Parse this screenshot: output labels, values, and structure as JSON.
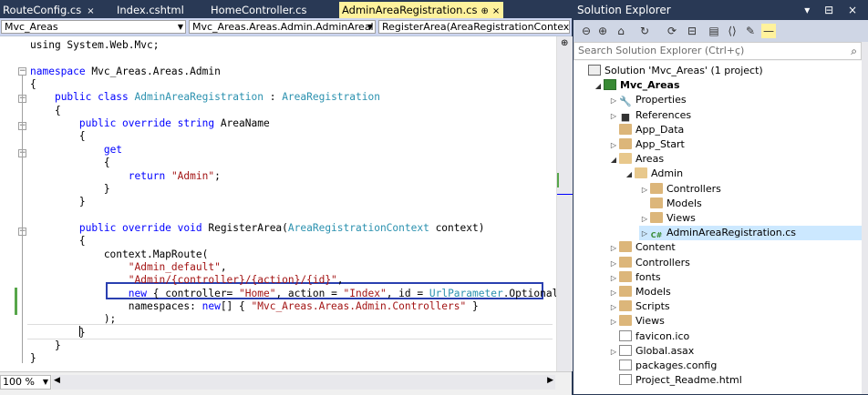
{
  "editor": {
    "tabs": [
      {
        "label": "RouteConfig.cs"
      },
      {
        "label": "Index.cshtml"
      },
      {
        "label": "HomeController.cs"
      },
      {
        "label": "AdminAreaRegistration.cs",
        "pin": "⊕",
        "close": "×",
        "active": true
      }
    ],
    "tab_close": "×",
    "navbar": {
      "project": "Mvc_Areas",
      "class": "Mvc_Areas.Areas.Admin.AdminAreal",
      "member": "RegisterArea(AreaRegistrationContex"
    },
    "code_lines": [
      [
        {
          "t": "using System.Web.Mvc;",
          "c": ""
        }
      ],
      [],
      [
        {
          "t": "namespace ",
          "c": "kw"
        },
        {
          "t": "Mvc_Areas.Areas.Admin",
          "c": ""
        }
      ],
      [
        {
          "t": "{",
          "c": ""
        }
      ],
      [
        {
          "t": "    ",
          "c": ""
        },
        {
          "t": "public class ",
          "c": "kw"
        },
        {
          "t": "AdminAreaRegistration",
          "c": "type"
        },
        {
          "t": " : ",
          "c": ""
        },
        {
          "t": "AreaRegistration",
          "c": "type"
        }
      ],
      [
        {
          "t": "    {",
          "c": ""
        }
      ],
      [
        {
          "t": "        ",
          "c": ""
        },
        {
          "t": "public override string ",
          "c": "kw"
        },
        {
          "t": "AreaName",
          "c": ""
        }
      ],
      [
        {
          "t": "        {",
          "c": ""
        }
      ],
      [
        {
          "t": "            ",
          "c": ""
        },
        {
          "t": "get",
          "c": "kw"
        }
      ],
      [
        {
          "t": "            {",
          "c": ""
        }
      ],
      [
        {
          "t": "                ",
          "c": ""
        },
        {
          "t": "return ",
          "c": "kw"
        },
        {
          "t": "\"Admin\"",
          "c": "str"
        },
        {
          "t": ";",
          "c": ""
        }
      ],
      [
        {
          "t": "            }",
          "c": ""
        }
      ],
      [
        {
          "t": "        }",
          "c": ""
        }
      ],
      [],
      [
        {
          "t": "        ",
          "c": ""
        },
        {
          "t": "public override void ",
          "c": "kw"
        },
        {
          "t": "RegisterArea(",
          "c": ""
        },
        {
          "t": "AreaRegistrationContext",
          "c": "type"
        },
        {
          "t": " context)",
          "c": ""
        }
      ],
      [
        {
          "t": "        {",
          "c": ""
        }
      ],
      [
        {
          "t": "            context.MapRoute(",
          "c": ""
        }
      ],
      [
        {
          "t": "                ",
          "c": ""
        },
        {
          "t": "\"Admin_default\"",
          "c": "str"
        },
        {
          "t": ",",
          "c": ""
        }
      ],
      [
        {
          "t": "                ",
          "c": ""
        },
        {
          "t": "\"Admin/{controller}/{action}/{id}\"",
          "c": "str"
        },
        {
          "t": ",",
          "c": ""
        }
      ],
      [
        {
          "t": "                ",
          "c": ""
        },
        {
          "t": "new ",
          "c": "kw"
        },
        {
          "t": "{ controller= ",
          "c": ""
        },
        {
          "t": "\"Home\"",
          "c": "str"
        },
        {
          "t": ", action = ",
          "c": ""
        },
        {
          "t": "\"Index\"",
          "c": "str"
        },
        {
          "t": ", id = ",
          "c": ""
        },
        {
          "t": "UrlParameter",
          "c": "type"
        },
        {
          "t": ".Optional },",
          "c": ""
        }
      ],
      [
        {
          "t": "                namespaces: ",
          "c": ""
        },
        {
          "t": "new",
          "c": "kw"
        },
        {
          "t": "[] { ",
          "c": ""
        },
        {
          "t": "\"Mvc_Areas.Areas.Admin.Controllers\"",
          "c": "str"
        },
        {
          "t": " }",
          "c": ""
        }
      ],
      [
        {
          "t": "            );",
          "c": ""
        }
      ],
      [
        {
          "t": "        }",
          "c": ""
        }
      ],
      [
        {
          "t": "    }",
          "c": ""
        }
      ],
      [
        {
          "t": "}",
          "c": ""
        }
      ]
    ],
    "zoom": "100 %"
  },
  "solution_explorer": {
    "title": "Solution Explorer",
    "title_controls": "▾ ⊟ ×",
    "search_placeholder": "Search Solution Explorer (Ctrl+ç)",
    "toolbar_icons": [
      "back-icon",
      "forward-icon",
      "home-icon",
      "sync-icon",
      "refresh-icon",
      "collapse-icon",
      "show-all-icon",
      "code-icon",
      "properties-icon",
      "preview-icon"
    ],
    "nodes": [
      {
        "label": "Solution 'Mvc_Areas' (1 project)",
        "depth": 0,
        "exp": "",
        "icon": "solution"
      },
      {
        "label": "Mvc_Areas",
        "depth": 1,
        "exp": "◢",
        "icon": "project",
        "bold": true
      },
      {
        "label": "Properties",
        "depth": 2,
        "exp": "▷",
        "icon": "gear"
      },
      {
        "label": "References",
        "depth": 2,
        "exp": "▷",
        "icon": "refs"
      },
      {
        "label": "App_Data",
        "depth": 2,
        "exp": "",
        "icon": "folder"
      },
      {
        "label": "App_Start",
        "depth": 2,
        "exp": "▷",
        "icon": "folder"
      },
      {
        "label": "Areas",
        "depth": 2,
        "exp": "◢",
        "icon": "folder-open"
      },
      {
        "label": "Admin",
        "depth": 3,
        "exp": "◢",
        "icon": "folder-open"
      },
      {
        "label": "Controllers",
        "depth": 4,
        "exp": "▷",
        "icon": "folder"
      },
      {
        "label": "Models",
        "depth": 4,
        "exp": "",
        "icon": "folder"
      },
      {
        "label": "Views",
        "depth": 4,
        "exp": "▷",
        "icon": "folder"
      },
      {
        "label": "AdminAreaRegistration.cs",
        "depth": 4,
        "exp": "▷",
        "icon": "cs",
        "selected": true
      },
      {
        "label": "Content",
        "depth": 2,
        "exp": "▷",
        "icon": "folder"
      },
      {
        "label": "Controllers",
        "depth": 2,
        "exp": "▷",
        "icon": "folder"
      },
      {
        "label": "fonts",
        "depth": 2,
        "exp": "▷",
        "icon": "folder"
      },
      {
        "label": "Models",
        "depth": 2,
        "exp": "▷",
        "icon": "folder"
      },
      {
        "label": "Scripts",
        "depth": 2,
        "exp": "▷",
        "icon": "folder"
      },
      {
        "label": "Views",
        "depth": 2,
        "exp": "▷",
        "icon": "folder"
      },
      {
        "label": "favicon.ico",
        "depth": 2,
        "exp": "",
        "icon": "file"
      },
      {
        "label": "Global.asax",
        "depth": 2,
        "exp": "▷",
        "icon": "file"
      },
      {
        "label": "packages.config",
        "depth": 2,
        "exp": "",
        "icon": "file"
      },
      {
        "label": "Project_Readme.html",
        "depth": 2,
        "exp": "",
        "icon": "file"
      }
    ]
  },
  "colors": {
    "keyword": "#0000ff",
    "type": "#2b91af",
    "string": "#a31515",
    "highlight_box": "#2a3fb0",
    "active_tab": "#fff29d",
    "change_bar": "#57a64a"
  }
}
